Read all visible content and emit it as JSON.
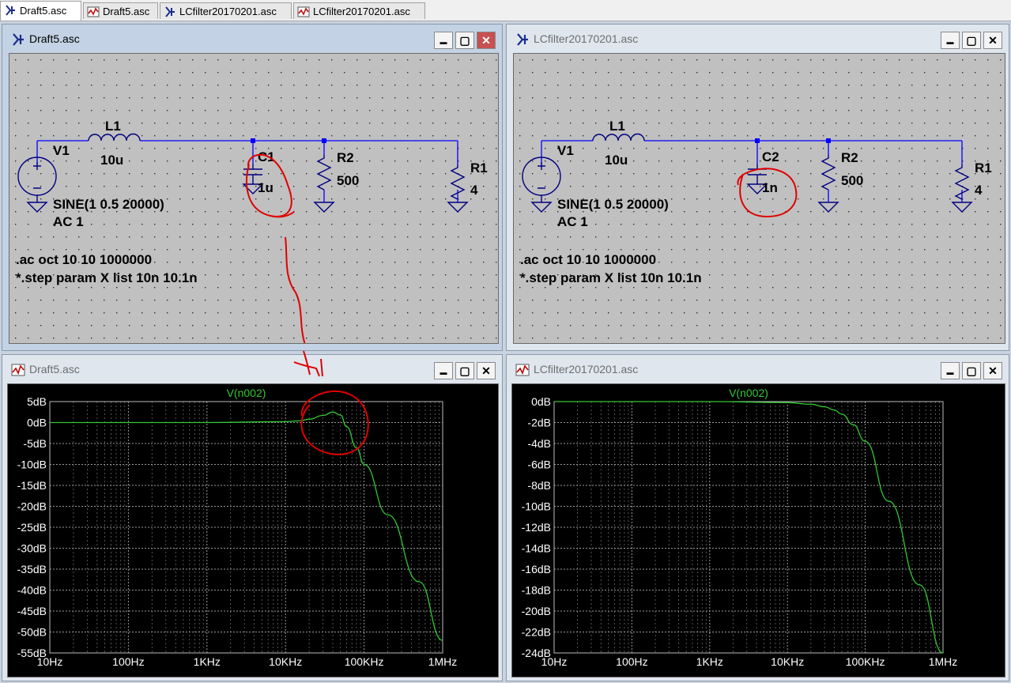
{
  "tabs": [
    {
      "label": "Draft5.asc",
      "icon": "schematic-icon",
      "active": true
    },
    {
      "label": "Draft5.asc",
      "icon": "waveform-icon",
      "active": false
    },
    {
      "label": "LCfilter20170201.asc",
      "icon": "schematic-icon",
      "active": false
    },
    {
      "label": "LCfilter20170201.asc",
      "icon": "waveform-icon",
      "active": false
    }
  ],
  "windows": {
    "sch_left": {
      "title": "Draft5.asc"
    },
    "sch_right": {
      "title": "LCfilter20170201.asc"
    },
    "wave_left": {
      "title": "Draft5.asc"
    },
    "wave_right": {
      "title": "LCfilter20170201.asc"
    }
  },
  "buttons": {
    "minimize": "▬",
    "maximize": "▢",
    "close": "✕"
  },
  "schematic_left": {
    "v1_name": "V1",
    "v1_value": "SINE(1 0.5 20000)",
    "v1_ac": "AC 1",
    "l1_name": "L1",
    "l1_value": "10u",
    "c_name": "C1",
    "c_value": "1u",
    "r2_name": "R2",
    "r2_value": "500",
    "r1_name": "R1",
    "r1_value": "4",
    "directive1": ".ac oct 10 10 1000000",
    "directive2": "*.step param X list 10n 10.1n"
  },
  "schematic_right": {
    "v1_name": "V1",
    "v1_value": "SINE(1 0.5 20000)",
    "v1_ac": "AC 1",
    "l1_name": "L1",
    "l1_value": "10u",
    "c_name": "C2",
    "c_value": "1n",
    "r2_name": "R2",
    "r2_value": "500",
    "r1_name": "R1",
    "r1_value": "4",
    "directive1": ".ac oct 10 10 1000000",
    "directive2": "*.step param X list 10n 10.1n"
  },
  "colors": {
    "wire": "#0000ff",
    "component": "#000080",
    "trace": "#32c832",
    "annotation": "#e00000",
    "plot_bg": "#000000",
    "grid": "#9a9a9a",
    "schematic_bg": "#c0c0c0"
  },
  "chart_data": [
    {
      "type": "line",
      "title": "V(n002)",
      "x_scale": "log",
      "xlim": [
        10,
        1000000
      ],
      "ylim": [
        -55,
        5
      ],
      "x_ticks": [
        "10Hz",
        "100Hz",
        "1KHz",
        "10KHz",
        "100KHz",
        "1MHz"
      ],
      "y_ticks": [
        "5dB",
        "0dB",
        "-5dB",
        "-10dB",
        "-15dB",
        "-20dB",
        "-25dB",
        "-30dB",
        "-35dB",
        "-40dB",
        "-45dB",
        "-50dB",
        "-55dB"
      ],
      "y_tick_values": [
        5,
        0,
        -5,
        -10,
        -15,
        -20,
        -25,
        -30,
        -35,
        -40,
        -45,
        -50,
        -55
      ],
      "grid": true,
      "series": [
        {
          "name": "V(n002)",
          "x": [
            10,
            1000,
            10000,
            15000,
            20000,
            30000,
            40000,
            50000,
            60000,
            80000,
            100000,
            200000,
            500000,
            1000000
          ],
          "y": [
            0,
            0,
            0.2,
            0.4,
            0.8,
            1.7,
            2.5,
            1.8,
            -1,
            -6,
            -10,
            -22,
            -38,
            -52
          ]
        }
      ]
    },
    {
      "type": "line",
      "title": "V(n002)",
      "x_scale": "log",
      "xlim": [
        10,
        1000000
      ],
      "ylim": [
        -24,
        0
      ],
      "x_ticks": [
        "10Hz",
        "100Hz",
        "1KHz",
        "10KHz",
        "100KHz",
        "1MHz"
      ],
      "y_ticks": [
        "0dB",
        "-2dB",
        "-4dB",
        "-6dB",
        "-8dB",
        "-10dB",
        "-12dB",
        "-14dB",
        "-16dB",
        "-18dB",
        "-20dB",
        "-22dB",
        "-24dB"
      ],
      "y_tick_values": [
        0,
        -2,
        -4,
        -6,
        -8,
        -10,
        -12,
        -14,
        -16,
        -18,
        -20,
        -22,
        -24
      ],
      "grid": true,
      "series": [
        {
          "name": "V(n002)",
          "x": [
            10,
            1000,
            10000,
            20000,
            30000,
            40000,
            50000,
            70000,
            100000,
            200000,
            500000,
            1000000
          ],
          "y": [
            0,
            0,
            -0.1,
            -0.25,
            -0.5,
            -0.8,
            -1.2,
            -2.2,
            -3.8,
            -9.5,
            -17.5,
            -24
          ]
        }
      ]
    }
  ]
}
